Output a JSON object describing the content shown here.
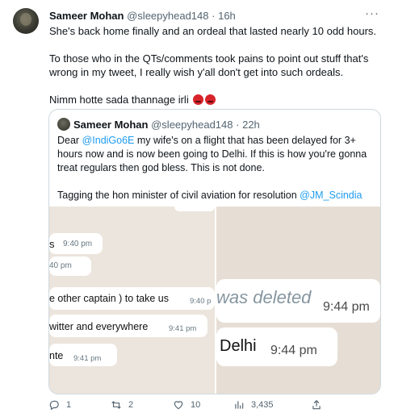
{
  "tweet": {
    "author_name": "Sameer Mohan",
    "handle": "@sleepyhead148",
    "separator": "·",
    "time": "16h",
    "more_label": "···",
    "paragraphs": [
      "She's back home finally and an ordeal that lasted nearly 10 odd hours.",
      "To those who in the QTs/comments took pains to point out stuff that's wrong in my tweet, I really wish y'all don't get into such ordeals.",
      "Nimm hotte sada thannage irli"
    ],
    "emojis": [
      "angry-face-emoji",
      "angry-face-emoji"
    ]
  },
  "quoted": {
    "author_name": "Sameer Mohan",
    "handle": "@sleepyhead148",
    "separator": "·",
    "time": "22h",
    "text_prefix": "Dear ",
    "mention_1": "@IndiGo6E",
    "text_main": " my wife's on a flight that has been delayed for 3+ hours now and is now been going to Delhi. If this is how you're gonna treat regulars then god bless. This is not done.",
    "text_2_prefix": "Tagging the hon minister of civil aviation for resolution ",
    "mention_2": "@JM_Scindia"
  },
  "media": {
    "left_bubbles": [
      {
        "text": "",
        "time": "9:40 pm"
      },
      {
        "text": "",
        "time": "9:40 pm"
      },
      {
        "text": "e other captain ) to take us",
        "time": "9:40 p"
      },
      {
        "text": "witter and everywhere",
        "time": "9:41 pm"
      },
      {
        "text": "nte",
        "time": "9:41 pm"
      }
    ],
    "left_fragments": [
      "s",
      "40 pm"
    ],
    "right_bubbles": [
      {
        "text": "was deleted",
        "time": "9:44 pm"
      },
      {
        "text": "Delhi",
        "time": "9:44 pm"
      }
    ]
  },
  "actions": {
    "replies": "1",
    "retweets": "2",
    "likes": "10",
    "views": "3,435"
  }
}
